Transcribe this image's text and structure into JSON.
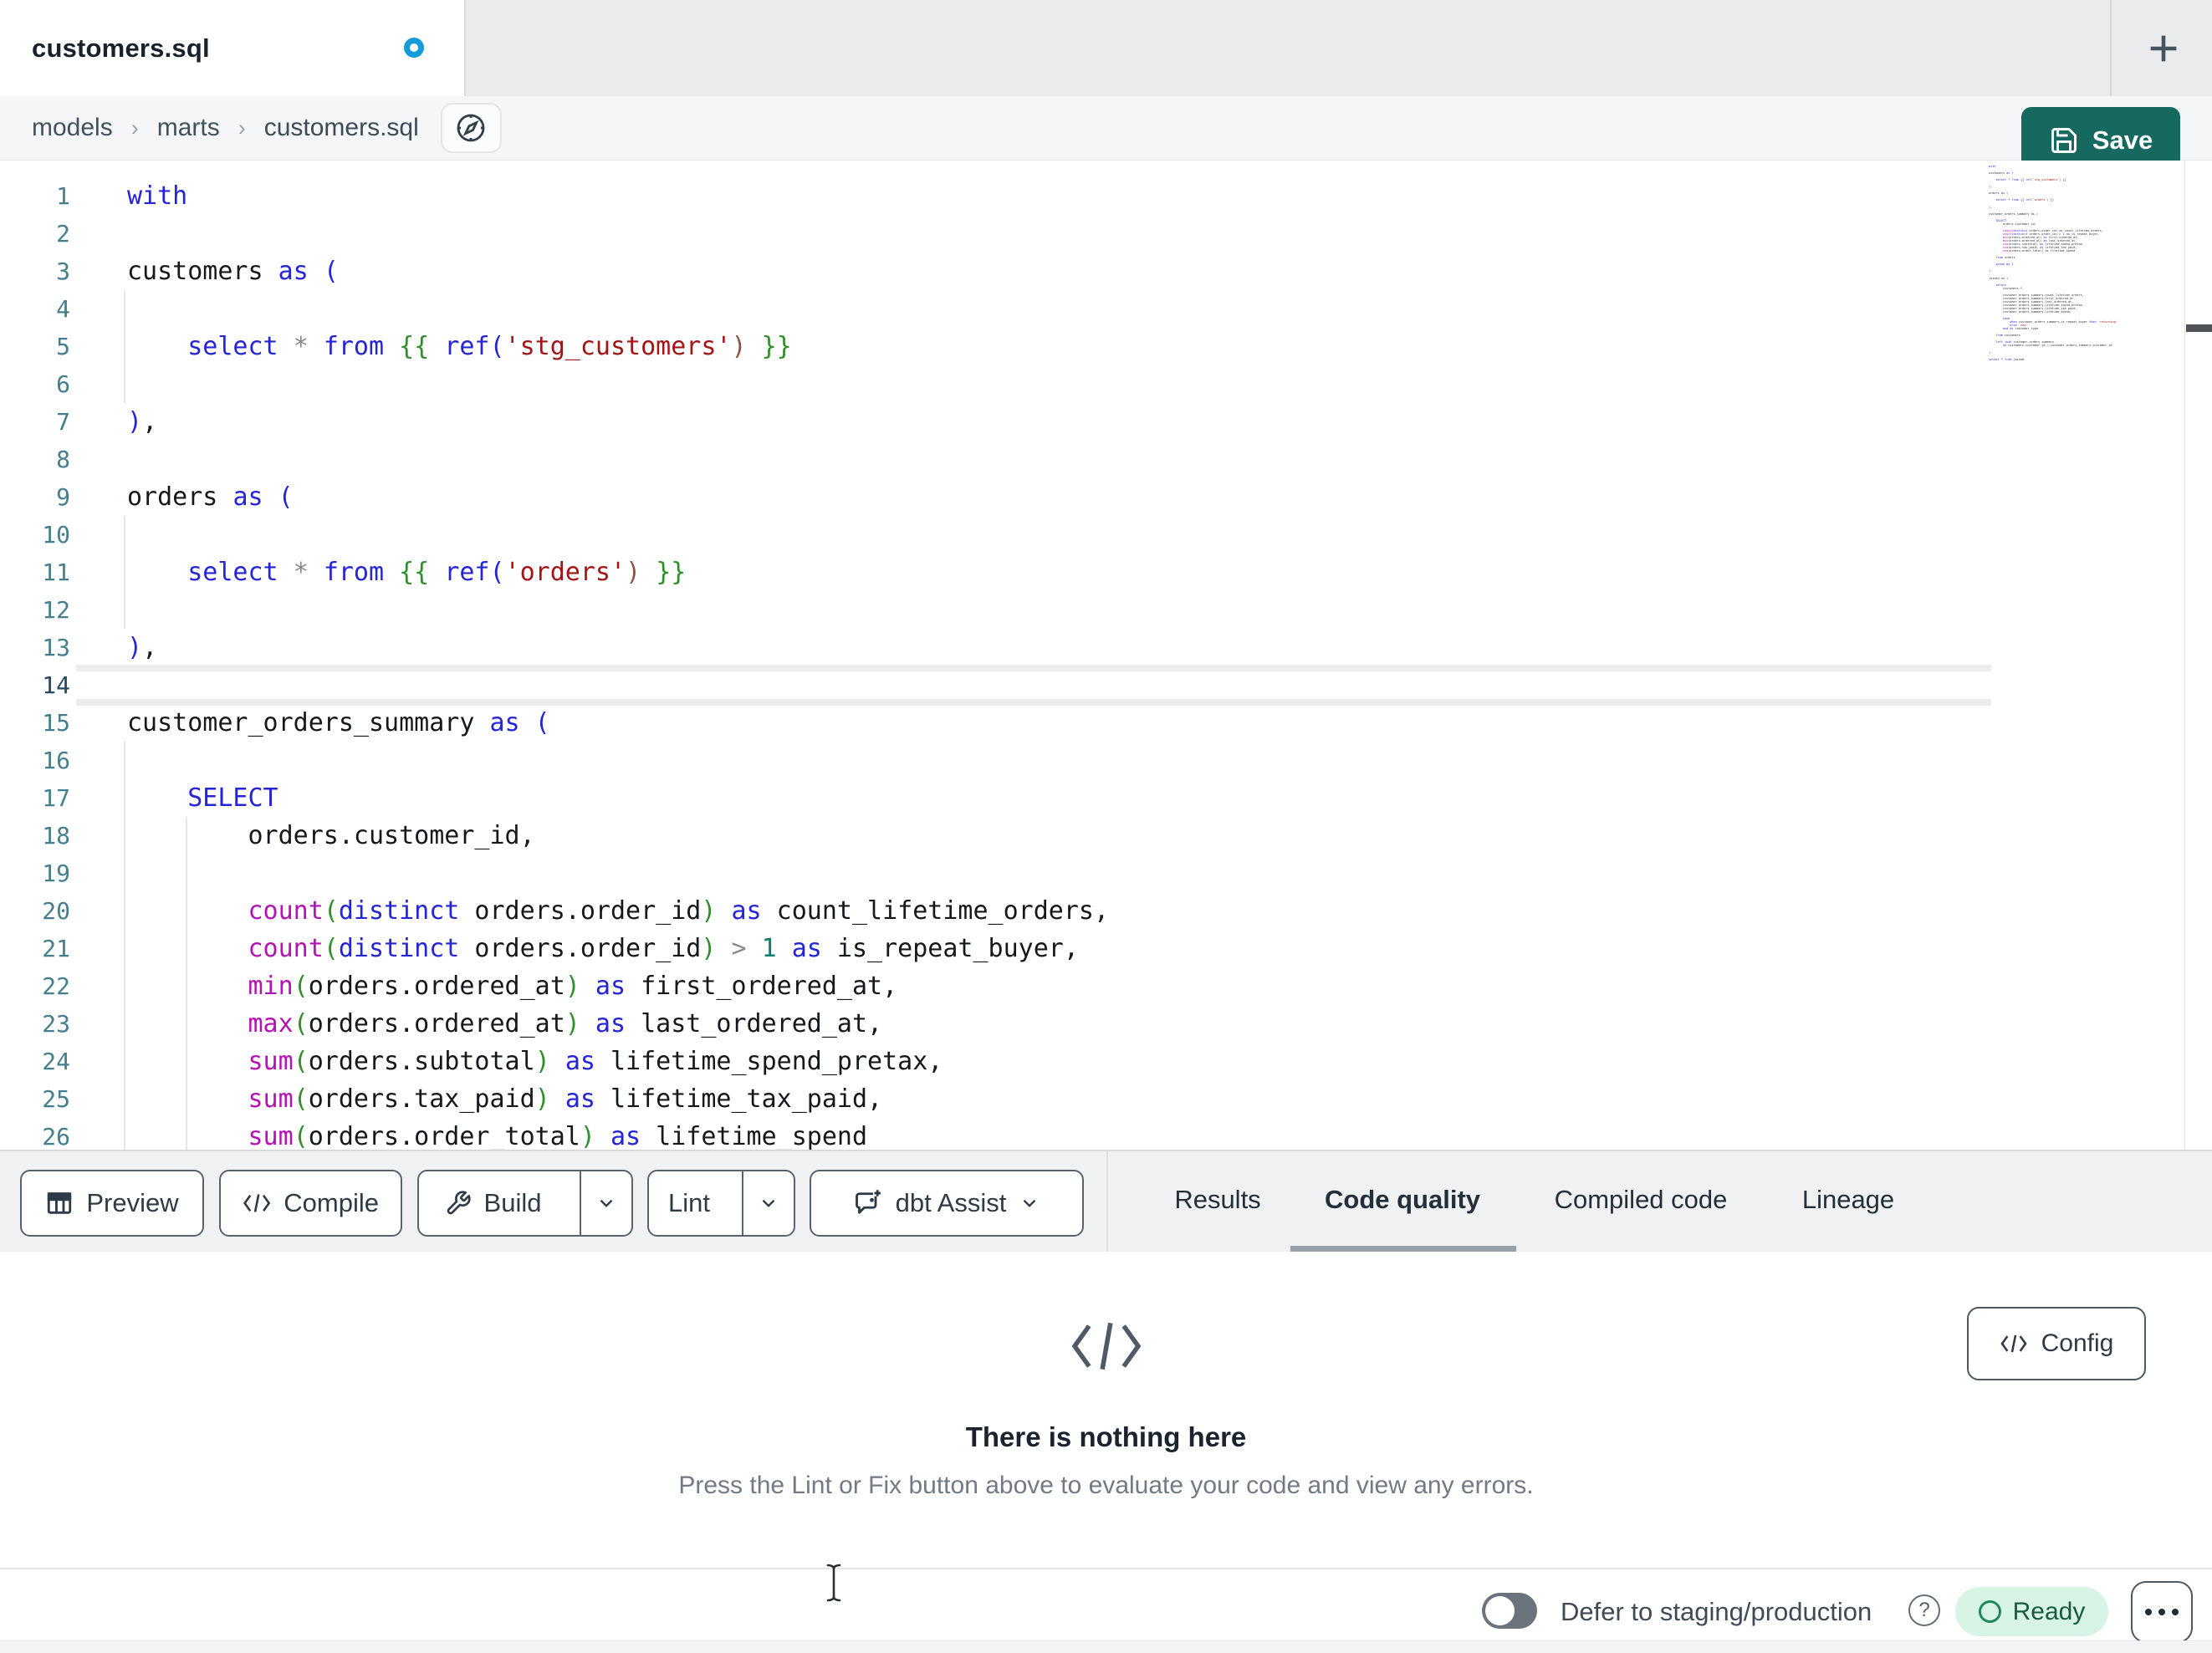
{
  "tab_bar": {
    "active_tab": "customers.sql"
  },
  "breadcrumb": {
    "items": [
      "models",
      "marts",
      "customers.sql"
    ],
    "separator": "›"
  },
  "save": {
    "label": "Save"
  },
  "toolbar": {
    "preview": "Preview",
    "compile": "Compile",
    "build": "Build",
    "lint": "Lint",
    "assist": "dbt Assist"
  },
  "panel_tabs": {
    "items": [
      "Results",
      "Code quality",
      "Compiled code",
      "Lineage"
    ],
    "active": "Code quality"
  },
  "empty_state": {
    "title": "There is nothing here",
    "description": "Press the Lint or Fix button above to evaluate your code and view any errors.",
    "config_label": "Config"
  },
  "status_bar": {
    "defer_label": "Defer to staging/production",
    "ready_label": "Ready"
  },
  "colors": {
    "accent_teal": "#15695f",
    "modified_dot_blue": "#169bd9",
    "ready_green_bg": "#d8f4e4",
    "ready_green_text": "#175c41",
    "active_tab_underline": "#9aa1a9",
    "line_number_teal": "#447f8f"
  },
  "editor": {
    "active_line": 14,
    "lines": [
      {
        "n": 1,
        "tokens": [
          [
            "k",
            "with"
          ]
        ]
      },
      {
        "n": 2,
        "tokens": []
      },
      {
        "n": 3,
        "tokens": [
          [
            "t",
            "customers "
          ],
          [
            "k",
            "as"
          ],
          [
            "t",
            " "
          ],
          [
            "k",
            "("
          ]
        ]
      },
      {
        "n": 4,
        "tokens": []
      },
      {
        "n": 5,
        "tokens": [
          [
            "t",
            "    "
          ],
          [
            "k",
            "select"
          ],
          [
            "t",
            " "
          ],
          [
            "o",
            "*"
          ],
          [
            "t",
            " "
          ],
          [
            "k",
            "from"
          ],
          [
            "t",
            " "
          ],
          [
            "g",
            "{{"
          ],
          [
            "t",
            " "
          ],
          [
            "k",
            "ref"
          ],
          [
            "k",
            "("
          ],
          [
            "s",
            "'stg_customers'"
          ],
          [
            "d",
            ")"
          ],
          [
            "t",
            " "
          ],
          [
            "g",
            "}}"
          ]
        ]
      },
      {
        "n": 6,
        "tokens": []
      },
      {
        "n": 7,
        "tokens": [
          [
            "k",
            ")"
          ],
          [
            "t",
            ","
          ]
        ]
      },
      {
        "n": 8,
        "tokens": []
      },
      {
        "n": 9,
        "tokens": [
          [
            "t",
            "orders "
          ],
          [
            "k",
            "as"
          ],
          [
            "t",
            " "
          ],
          [
            "k",
            "("
          ]
        ]
      },
      {
        "n": 10,
        "tokens": []
      },
      {
        "n": 11,
        "tokens": [
          [
            "t",
            "    "
          ],
          [
            "k",
            "select"
          ],
          [
            "t",
            " "
          ],
          [
            "o",
            "*"
          ],
          [
            "t",
            " "
          ],
          [
            "k",
            "from"
          ],
          [
            "t",
            " "
          ],
          [
            "g",
            "{{"
          ],
          [
            "t",
            " "
          ],
          [
            "k",
            "ref"
          ],
          [
            "k",
            "("
          ],
          [
            "s",
            "'orders'"
          ],
          [
            "d",
            ")"
          ],
          [
            "t",
            " "
          ],
          [
            "g",
            "}}"
          ]
        ]
      },
      {
        "n": 12,
        "tokens": []
      },
      {
        "n": 13,
        "tokens": [
          [
            "k",
            ")"
          ],
          [
            "t",
            ","
          ]
        ]
      },
      {
        "n": 14,
        "tokens": []
      },
      {
        "n": 15,
        "tokens": [
          [
            "t",
            "customer_orders_summary "
          ],
          [
            "k",
            "as"
          ],
          [
            "t",
            " "
          ],
          [
            "k",
            "("
          ]
        ]
      },
      {
        "n": 16,
        "tokens": []
      },
      {
        "n": 17,
        "tokens": [
          [
            "t",
            "    "
          ],
          [
            "k",
            "SELECT"
          ]
        ]
      },
      {
        "n": 18,
        "tokens": [
          [
            "t",
            "        orders.customer_id,"
          ]
        ]
      },
      {
        "n": 19,
        "tokens": []
      },
      {
        "n": 20,
        "tokens": [
          [
            "t",
            "        "
          ],
          [
            "f",
            "count"
          ],
          [
            "g",
            "("
          ],
          [
            "k",
            "distinct"
          ],
          [
            "t",
            " orders.order_id"
          ],
          [
            "g",
            ")"
          ],
          [
            "t",
            " "
          ],
          [
            "k",
            "as"
          ],
          [
            "t",
            " count_lifetime_orders,"
          ]
        ]
      },
      {
        "n": 21,
        "tokens": [
          [
            "t",
            "        "
          ],
          [
            "f",
            "count"
          ],
          [
            "g",
            "("
          ],
          [
            "k",
            "distinct"
          ],
          [
            "t",
            " orders.order_id"
          ],
          [
            "g",
            ")"
          ],
          [
            "t",
            " "
          ],
          [
            "o",
            ">"
          ],
          [
            "t",
            " "
          ],
          [
            "n",
            "1"
          ],
          [
            "t",
            " "
          ],
          [
            "k",
            "as"
          ],
          [
            "t",
            " is_repeat_buyer,"
          ]
        ]
      },
      {
        "n": 22,
        "tokens": [
          [
            "t",
            "        "
          ],
          [
            "f",
            "min"
          ],
          [
            "g",
            "("
          ],
          [
            "t",
            "orders.ordered_at"
          ],
          [
            "g",
            ")"
          ],
          [
            "t",
            " "
          ],
          [
            "k",
            "as"
          ],
          [
            "t",
            " first_ordered_at,"
          ]
        ]
      },
      {
        "n": 23,
        "tokens": [
          [
            "t",
            "        "
          ],
          [
            "f",
            "max"
          ],
          [
            "g",
            "("
          ],
          [
            "t",
            "orders.ordered_at"
          ],
          [
            "g",
            ")"
          ],
          [
            "t",
            " "
          ],
          [
            "k",
            "as"
          ],
          [
            "t",
            " last_ordered_at,"
          ]
        ]
      },
      {
        "n": 24,
        "tokens": [
          [
            "t",
            "        "
          ],
          [
            "f",
            "sum"
          ],
          [
            "g",
            "("
          ],
          [
            "t",
            "orders.subtotal"
          ],
          [
            "g",
            ")"
          ],
          [
            "t",
            " "
          ],
          [
            "k",
            "as"
          ],
          [
            "t",
            " lifetime_spend_pretax,"
          ]
        ]
      },
      {
        "n": 25,
        "tokens": [
          [
            "t",
            "        "
          ],
          [
            "f",
            "sum"
          ],
          [
            "g",
            "("
          ],
          [
            "t",
            "orders.tax_paid"
          ],
          [
            "g",
            ")"
          ],
          [
            "t",
            " "
          ],
          [
            "k",
            "as"
          ],
          [
            "t",
            " lifetime_tax_paid,"
          ]
        ]
      },
      {
        "n": 26,
        "tokens": [
          [
            "t",
            "        "
          ],
          [
            "f",
            "sum"
          ],
          [
            "g",
            "("
          ],
          [
            "t",
            "orders.order_total"
          ],
          [
            "g",
            ")"
          ],
          [
            "t",
            " "
          ],
          [
            "k",
            "as"
          ],
          [
            "t",
            " lifetime_spend"
          ]
        ]
      }
    ]
  },
  "minimap": {
    "lines": [
      "with",
      "",
      "customers as (",
      "",
      "    select * from {{ ref('stg_customers') }}",
      "",
      "),",
      "",
      "orders as (",
      "",
      "    select * from {{ ref('orders') }}",
      "",
      "),",
      "",
      "customer_orders_summary as (",
      "",
      "    SELECT",
      "        orders.customer_id,",
      "",
      "        count(distinct orders.order_id) as count_lifetime_orders,",
      "        count(distinct orders.order_id) > 1 as is_repeat_buyer,",
      "        min(orders.ordered_at) as first_ordered_at,",
      "        max(orders.ordered_at) as last_ordered_at,",
      "        sum(orders.subtotal) as lifetime_spend_pretax,",
      "        sum(orders.tax_paid) as lifetime_tax_paid,",
      "        sum(orders.order_total) as lifetime_spend",
      "",
      "    from orders",
      "",
      "    group by 1",
      "",
      "),",
      "",
      "joined as (",
      "",
      "    select",
      "        customers.*,",
      "",
      "        customer_orders_summary.count_lifetime_orders,",
      "        customer_orders_summary.first_ordered_at,",
      "        customer_orders_summary.last_ordered_at,",
      "        customer_orders_summary.lifetime_spend_pretax,",
      "        customer_orders_summary.lifetime_tax_paid,",
      "        customer_orders_summary.lifetime_spend,",
      "",
      "        case",
      "            when customer_orders_summary.is_repeat_buyer then 'returning'",
      "            else 'new'",
      "        end as customer_type",
      "",
      "    from customers",
      "",
      "    left join customer_orders_summary",
      "        on customers.customer_id = customer_orders_summary.customer_id",
      "",
      ")",
      "",
      "select * from joined"
    ]
  }
}
